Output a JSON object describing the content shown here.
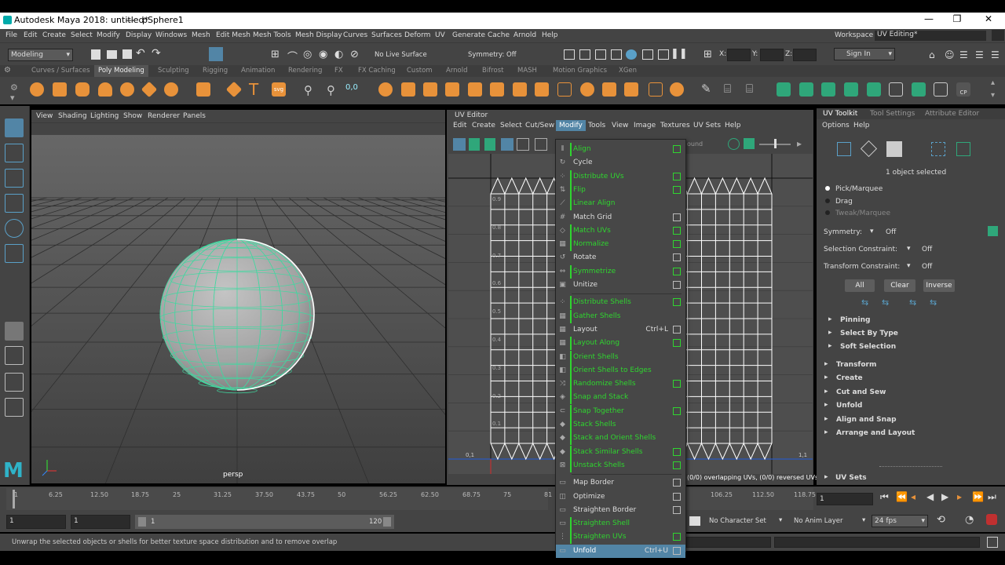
{
  "window": {
    "title": "Autodesk Maya 2018: untitled*",
    "separator": "---",
    "object": "pSphere1",
    "minimize": "—",
    "maximize": "❐",
    "close": "✕"
  },
  "menubar": [
    "File",
    "Edit",
    "Create",
    "Select",
    "Modify",
    "Display",
    "Windows",
    "Mesh",
    "Edit Mesh",
    "Mesh Tools",
    "Mesh Display",
    "Curves",
    "Surfaces",
    "Deform",
    "UV",
    "Generate",
    "Cache",
    "Arnold",
    "Help"
  ],
  "workspace": {
    "label": "Workspace :",
    "value": "UV Editing*"
  },
  "statusline": {
    "menuset": "Modeling",
    "live_surface": "No Live Surface",
    "symmetry": "Symmetry: Off",
    "x_label": "X:",
    "y_label": "Y:",
    "z_label": "Z:",
    "sign_in": "Sign In"
  },
  "shelf_tabs": [
    "Curves / Surfaces",
    "Poly Modeling",
    "Sculpting",
    "Rigging",
    "Animation",
    "Rendering",
    "FX",
    "FX Caching",
    "Custom",
    "Arnold",
    "Bifrost",
    "MASH",
    "Motion Graphics",
    "XGen"
  ],
  "shelf_active": "Poly Modeling",
  "viewport": {
    "menus": [
      "View",
      "Shading",
      "Lighting",
      "Show",
      "Renderer",
      "Panels"
    ],
    "camera": "persp"
  },
  "uv_editor": {
    "title": "UV Editor",
    "menus": [
      "Edit",
      "Create",
      "Select",
      "Cut/Sew",
      "Modify",
      "Tools",
      "View",
      "Image",
      "Textures",
      "UV Sets",
      "Help"
    ],
    "status": "(0/0) overlapping UVs, (0/0) reversed UVs",
    "bound_fragment": "ound",
    "corner_left": "0,1",
    "corner_right": "1,1",
    "grid_labels": [
      "0.9",
      "0.8",
      "0.7",
      "0.6",
      "0.5",
      "0.4",
      "0.3",
      "0.2",
      "0.1"
    ]
  },
  "modify_menu": [
    {
      "label": "Align",
      "hl": true,
      "box": true
    },
    {
      "label": "Cycle",
      "hl": false,
      "box": false
    },
    {
      "label": "Distribute UVs",
      "hl": true,
      "box": true
    },
    {
      "label": "Flip",
      "hl": true,
      "box": true
    },
    {
      "label": "Linear Align",
      "hl": true,
      "box": false
    },
    {
      "label": "Match Grid",
      "hl": false,
      "box": true
    },
    {
      "label": "Match UVs",
      "hl": true,
      "box": true
    },
    {
      "label": "Normalize",
      "hl": true,
      "box": true
    },
    {
      "label": "Rotate",
      "hl": false,
      "box": true
    },
    {
      "label": "Symmetrize",
      "hl": true,
      "box": true
    },
    {
      "label": "Unitize",
      "hl": false,
      "box": true
    },
    {
      "sep": true
    },
    {
      "label": "Distribute Shells",
      "hl": true,
      "box": true
    },
    {
      "label": "Gather Shells",
      "hl": true,
      "box": false
    },
    {
      "label": "Layout",
      "hl": false,
      "box": true,
      "shortcut": "Ctrl+L"
    },
    {
      "label": "Layout Along",
      "hl": true,
      "box": true
    },
    {
      "label": "Orient Shells",
      "hl": true,
      "box": false
    },
    {
      "label": "Orient Shells to Edges",
      "hl": true,
      "box": false
    },
    {
      "label": "Randomize Shells",
      "hl": true,
      "box": true
    },
    {
      "label": "Snap and Stack",
      "hl": true,
      "box": false
    },
    {
      "label": "Snap Together",
      "hl": true,
      "box": true
    },
    {
      "label": "Stack Shells",
      "hl": true,
      "box": false
    },
    {
      "label": "Stack and Orient Shells",
      "hl": true,
      "box": false
    },
    {
      "label": "Stack Similar Shells",
      "hl": true,
      "box": true
    },
    {
      "label": "Unstack Shells",
      "hl": true,
      "box": true
    },
    {
      "sep": true
    },
    {
      "label": "Map Border",
      "hl": false,
      "box": true
    },
    {
      "label": "Optimize",
      "hl": false,
      "box": true
    },
    {
      "label": "Straighten Border",
      "hl": false,
      "box": true
    },
    {
      "label": "Straighten Shell",
      "hl": true,
      "box": false
    },
    {
      "label": "Straighten UVs",
      "hl": true,
      "box": true
    },
    {
      "label": "Unfold",
      "hl": false,
      "box": true,
      "shortcut": "Ctrl+U",
      "sel": true
    }
  ],
  "uv_toolkit": {
    "tabs": [
      "UV Toolkit",
      "Tool Settings",
      "Attribute Editor"
    ],
    "menus": [
      "Options",
      "Help"
    ],
    "selected_info": "1 object selected",
    "modes": [
      "Pick/Marquee",
      "Drag",
      "Tweak/Marquee"
    ],
    "symmetry_label": "Symmetry:",
    "symmetry_value": "Off",
    "selection_constraint_label": "Selection Constraint:",
    "selection_constraint_value": "Off",
    "transform_constraint_label": "Transform Constraint:",
    "transform_constraint_value": "Off",
    "buttons": [
      "All",
      "Clear",
      "Inverse"
    ],
    "subsections": [
      "Pinning",
      "Select By Type",
      "Soft Selection"
    ],
    "sections": [
      "Transform",
      "Create",
      "Cut and Sew",
      "Unfold",
      "Align and Snap",
      "Arrange and Layout"
    ],
    "uv_sets": "UV Sets"
  },
  "timeline": {
    "ticks": [
      "1",
      "6.25",
      "12.50",
      "18.75",
      "25",
      "31.25",
      "37.50",
      "43.75",
      "50",
      "56.25",
      "62.50",
      "68.75",
      "75",
      "81",
      "106.25",
      "112.50",
      "118.75"
    ],
    "current_frame": "1"
  },
  "range": {
    "start": "1",
    "start_inner": "1",
    "range_start": "1",
    "range_end": "120",
    "character_set": "No Character Set",
    "anim_layer": "No Anim Layer",
    "fps": "24 fps"
  },
  "help_line": "Unwrap the selected objects or shells for better texture space distribution and to remove overlap",
  "colors": {
    "accent": "#2fd52f",
    "selection": "#5285a6",
    "wire": "#3fd9a0"
  }
}
